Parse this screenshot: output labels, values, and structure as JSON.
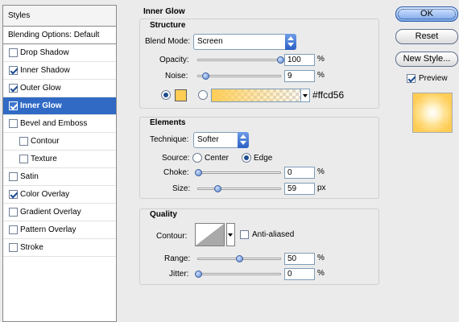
{
  "styles_panel": {
    "header": "Styles",
    "blending_options": "Blending Options: Default",
    "items": [
      {
        "label": "Drop Shadow",
        "checked": false,
        "selected": false,
        "sub": false
      },
      {
        "label": "Inner Shadow",
        "checked": true,
        "selected": false,
        "sub": false
      },
      {
        "label": "Outer Glow",
        "checked": true,
        "selected": false,
        "sub": false
      },
      {
        "label": "Inner Glow",
        "checked": true,
        "selected": true,
        "sub": false
      },
      {
        "label": "Bevel and Emboss",
        "checked": false,
        "selected": false,
        "sub": false
      },
      {
        "label": "Contour",
        "checked": false,
        "selected": false,
        "sub": true
      },
      {
        "label": "Texture",
        "checked": false,
        "selected": false,
        "sub": true
      },
      {
        "label": "Satin",
        "checked": false,
        "selected": false,
        "sub": false
      },
      {
        "label": "Color Overlay",
        "checked": true,
        "selected": false,
        "sub": false
      },
      {
        "label": "Gradient Overlay",
        "checked": false,
        "selected": false,
        "sub": false
      },
      {
        "label": "Pattern Overlay",
        "checked": false,
        "selected": false,
        "sub": false
      },
      {
        "label": "Stroke",
        "checked": false,
        "selected": false,
        "sub": false
      }
    ]
  },
  "inner_glow": {
    "title": "Inner Glow",
    "structure": {
      "title": "Structure",
      "blend_mode_label": "Blend Mode:",
      "blend_mode_value": "Screen",
      "opacity_label": "Opacity:",
      "opacity_value": "100",
      "opacity_fraction": 1.0,
      "noise_label": "Noise:",
      "noise_value": "9",
      "noise_fraction": 0.09,
      "percent": "%",
      "color_hex_label": "#ffcd56",
      "glow_color": "#ffcd56"
    },
    "elements": {
      "title": "Elements",
      "technique_label": "Technique:",
      "technique_value": "Softer",
      "source_label": "Source:",
      "source_center": "Center",
      "source_edge": "Edge",
      "source_selected": "Edge",
      "choke_label": "Choke:",
      "choke_value": "0",
      "choke_fraction": 0.0,
      "size_label": "Size:",
      "size_value": "59",
      "size_fraction": 0.24,
      "size_unit": "px"
    },
    "quality": {
      "title": "Quality",
      "contour_label": "Contour:",
      "anti_aliased_label": "Anti-aliased",
      "anti_aliased_checked": false,
      "range_label": "Range:",
      "range_value": "50",
      "range_fraction": 0.5,
      "jitter_label": "Jitter:",
      "jitter_value": "0",
      "jitter_fraction": 0.0
    }
  },
  "buttons": {
    "ok": "OK",
    "reset": "Reset",
    "new_style": "New Style...",
    "preview_label": "Preview",
    "preview_checked": true
  }
}
